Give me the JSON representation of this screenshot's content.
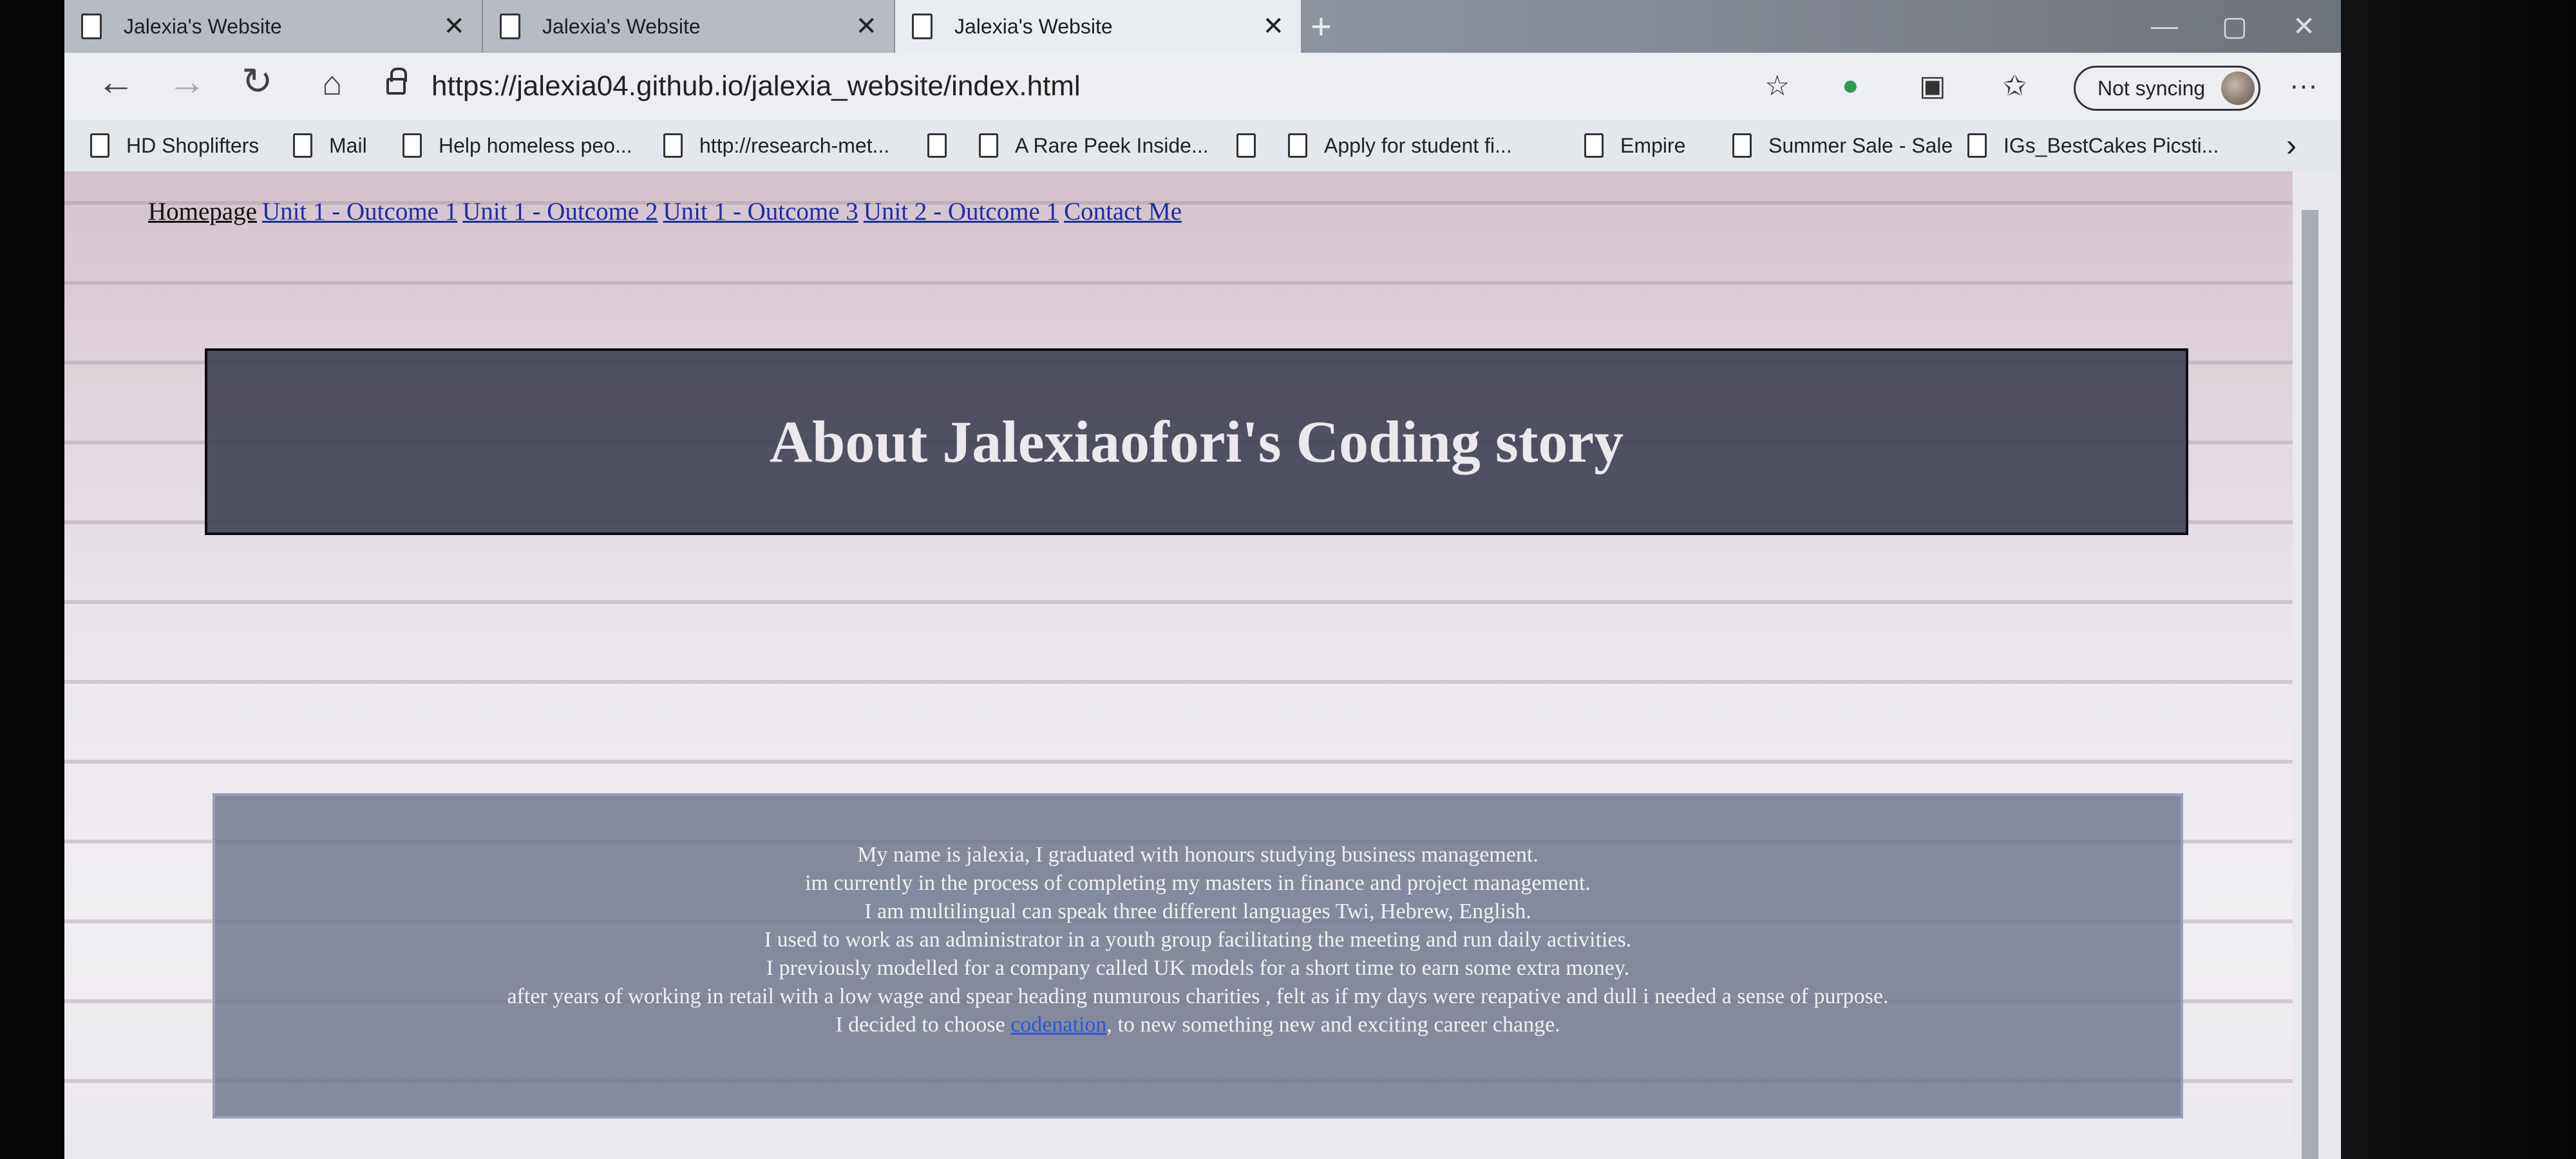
{
  "tabs": [
    {
      "title": "Jalexia's Website",
      "close": "✕"
    },
    {
      "title": "Jalexia's Website",
      "close": "✕"
    },
    {
      "title": "Jalexia's Website",
      "close": "✕"
    }
  ],
  "new_tab_symbol": "+",
  "window_controls": {
    "minimize": "—",
    "maximize": "▢",
    "close": "✕"
  },
  "address_bar": {
    "url": "https://jalexia04.github.io/jalexia_website/index.html"
  },
  "toolbar": {
    "sync_label": "Not syncing",
    "more": "···"
  },
  "bookmarks": [
    {
      "label": "HD Shoplifters"
    },
    {
      "label": "Mail"
    },
    {
      "label": "Help homeless peo..."
    },
    {
      "label": "http://research-met..."
    },
    {
      "label": ""
    },
    {
      "label": "A Rare Peek Inside..."
    },
    {
      "label": ""
    },
    {
      "label": "Apply for student fi..."
    },
    {
      "label": "Empire"
    },
    {
      "label": "Summer Sale - Sale"
    },
    {
      "label": "IGs_BestCakes Picsti..."
    }
  ],
  "bookmarks_more": "›",
  "page": {
    "nav_links": [
      "Homepage",
      "Unit 1 - Outcome 1",
      "Unit 1 - Outcome 2",
      "Unit 1 - Outcome 3",
      "Unit 2 - Outcome 1",
      "Contact Me"
    ],
    "title": "About Jalexiaofori's Coding story",
    "about_lines": [
      "My name is jalexia, I graduated with honours studying business management.",
      "im currently in the process of completing my masters in finance and project management.",
      "I am multilingual can speak three different languages Twi, Hebrew, English.",
      "I used to work as an administrator in a youth group facilitating the meeting and run daily activities.",
      "I previously modelled for a company called UK models for a short time to earn some extra money.",
      "after years of working in retail with a low wage and spear heading numurous charities , felt as if my days were reapative and dull i needed a sense of purpose."
    ],
    "last_line_prefix": "I decided to choose ",
    "last_line_link": "codenation",
    "last_line_suffix": ", to new something new and exciting career change."
  },
  "colors": {
    "link": "#1c2da8",
    "title_box": "#3a3c4e",
    "about_box": "#69708a",
    "inline_link": "#2b58d8"
  }
}
